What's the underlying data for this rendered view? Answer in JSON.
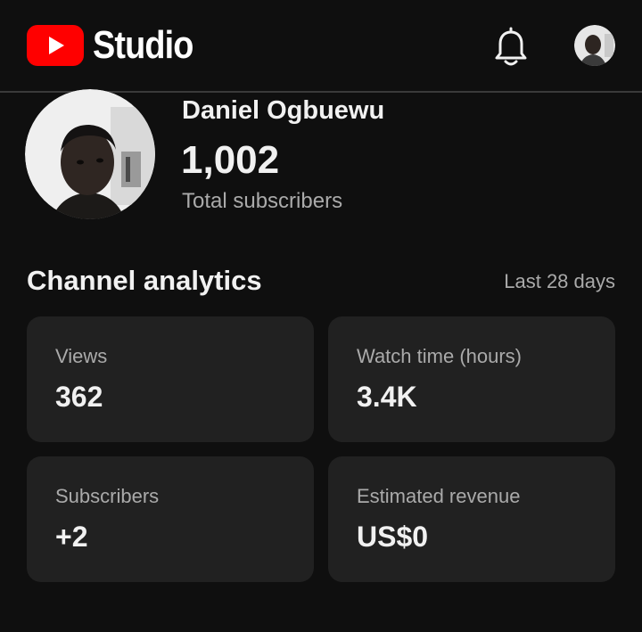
{
  "header": {
    "logo_text": "Studio",
    "icons": {
      "logo": "youtube-play-icon",
      "notifications": "bell-icon",
      "account": "avatar"
    }
  },
  "profile": {
    "channel_name": "Daniel Ogbuewu",
    "subscriber_count": "1,002",
    "subscriber_label": "Total subscribers"
  },
  "analytics": {
    "title": "Channel analytics",
    "period": "Last 28 days",
    "cards": [
      {
        "label": "Views",
        "value": "362"
      },
      {
        "label": "Watch time (hours)",
        "value": "3.4K"
      },
      {
        "label": "Subscribers",
        "value": "+2"
      },
      {
        "label": "Estimated revenue",
        "value": "US$0"
      }
    ]
  },
  "colors": {
    "background": "#0f0f0f",
    "card": "#212121",
    "brand_red": "#ff0000",
    "primary_text": "#f1f1f1",
    "secondary_text": "#aaaaaa"
  }
}
